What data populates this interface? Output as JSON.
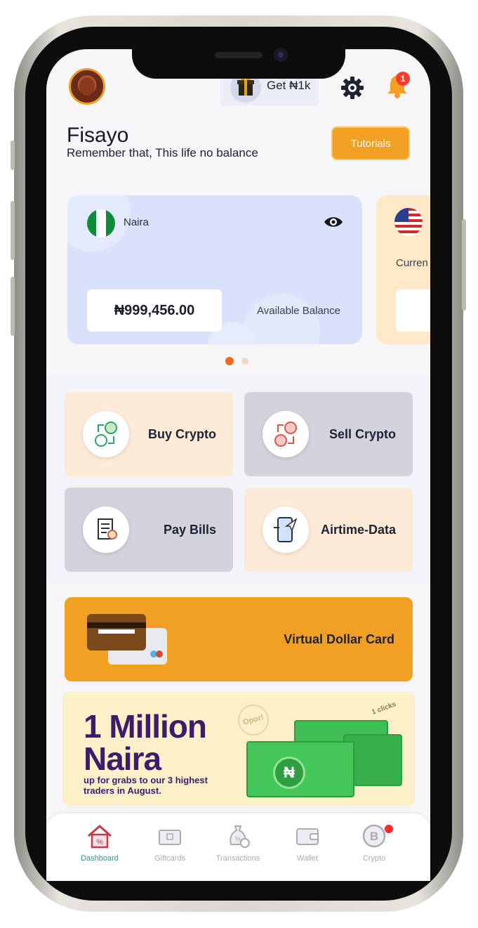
{
  "header": {
    "promo_button_label": "Get ₦1k",
    "notification_count": "1"
  },
  "user": {
    "name": "Fisayo",
    "motto": "Remember that, This life no balance",
    "tutorials_label": "Tutorials"
  },
  "balance_cards": [
    {
      "currency": "Naira",
      "balance": "₦999,456.00",
      "balance_label": "Available Balance",
      "flag": "nigeria-flag"
    },
    {
      "currency": "Curren",
      "flag": "usa-flag"
    }
  ],
  "carousel": {
    "active_index": 0,
    "count": 2
  },
  "actions": [
    {
      "label": "Buy Crypto",
      "icon": "crypto-exchange-icon"
    },
    {
      "label": "Sell Crypto",
      "icon": "crypto-exchange-icon"
    },
    {
      "label": "Pay Bills",
      "icon": "bill-icon"
    },
    {
      "label": "Airtime-Data",
      "icon": "phone-send-icon"
    }
  ],
  "virtual_card": {
    "label": "Virtual Dollar Card"
  },
  "promo": {
    "headline_line1": "1 Million",
    "headline_line2": "Naira",
    "subtext": "up for grabs to our 3 highest traders in August.",
    "logo_text": "Opor!",
    "tag_text": "1 clicks",
    "coin_symbol": "₦"
  },
  "nav": [
    {
      "label": "Dashboard",
      "icon": "home-icon",
      "active": true
    },
    {
      "label": "Giftcards",
      "icon": "giftcard-icon",
      "active": false
    },
    {
      "label": "Transactions",
      "icon": "money-bag-icon",
      "active": false
    },
    {
      "label": "Wallet",
      "icon": "wallet-icon",
      "active": false
    },
    {
      "label": "Crypto",
      "icon": "bitcoin-icon",
      "active": false
    }
  ],
  "colors": {
    "accent": "#f2a023",
    "active_tab": "#2a9b8f",
    "notification": "#ff3b30"
  }
}
